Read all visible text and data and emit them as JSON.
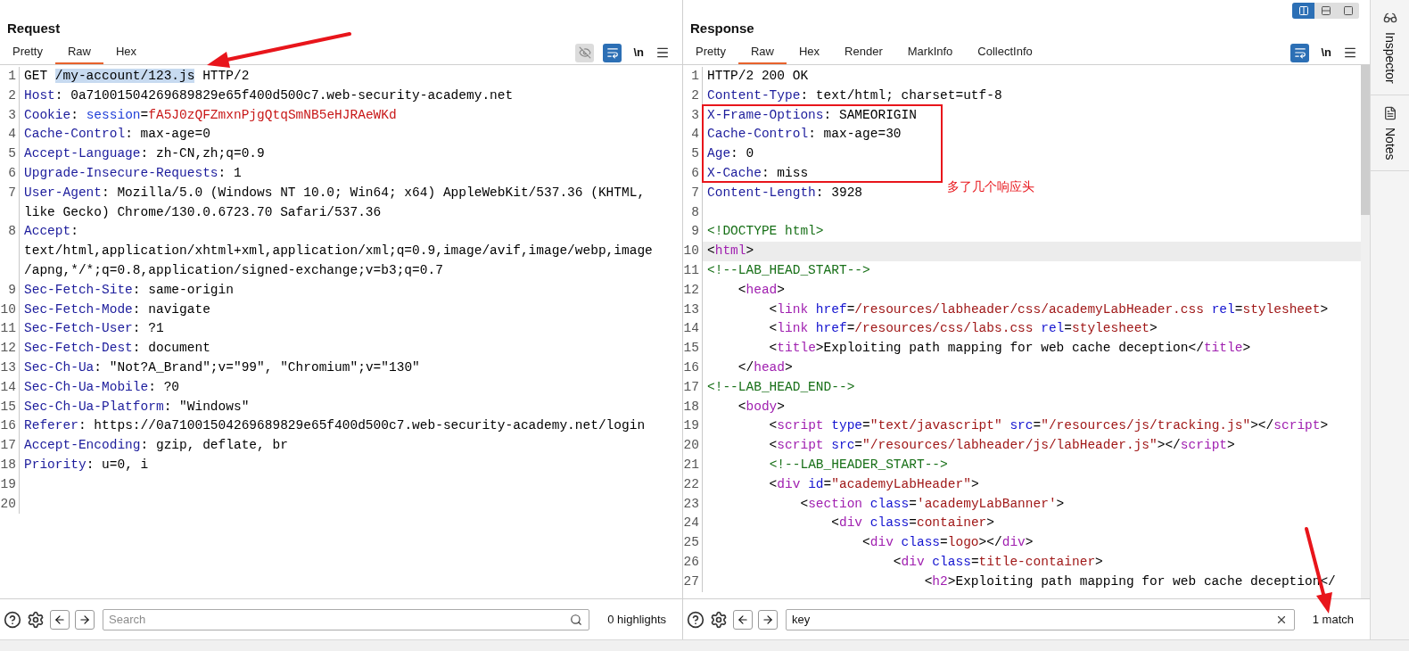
{
  "layout_toggle": [
    {
      "kind": "columns",
      "selected": true
    },
    {
      "kind": "rows",
      "selected": false
    },
    {
      "kind": "single",
      "selected": false
    }
  ],
  "request": {
    "title": "Request",
    "tabs": [
      {
        "label": "Pretty",
        "selected": false
      },
      {
        "label": "Raw",
        "selected": true
      },
      {
        "label": "Hex",
        "selected": false
      }
    ],
    "newline_toggle": "\\n",
    "lines": [
      {
        "number": "1",
        "rows": [
          [
            {
              "kind": "plain",
              "text": "GET "
            },
            {
              "kind": "selected",
              "text": "/my-account/123.js"
            },
            {
              "kind": "plain",
              "text": " HTTP/2"
            }
          ]
        ]
      },
      {
        "number": "2",
        "rows": [
          [
            {
              "kind": "name",
              "text": "Host"
            },
            {
              "kind": "plain",
              "text": ": 0a71001504269689829e65f400d500c7.web-security-academy.net"
            }
          ]
        ]
      },
      {
        "number": "3",
        "rows": [
          [
            {
              "kind": "name",
              "text": "Cookie"
            },
            {
              "kind": "plain",
              "text": ": "
            },
            {
              "kind": "cname",
              "text": "session"
            },
            {
              "kind": "plain",
              "text": "="
            },
            {
              "kind": "cvalue",
              "text": "fA5J0zQFZmxnPjgQtqSmNB5eHJRAeWKd"
            }
          ]
        ]
      },
      {
        "number": "4",
        "rows": [
          [
            {
              "kind": "name",
              "text": "Cache-Control"
            },
            {
              "kind": "plain",
              "text": ": max-age=0"
            }
          ]
        ]
      },
      {
        "number": "5",
        "rows": [
          [
            {
              "kind": "name",
              "text": "Accept-Language"
            },
            {
              "kind": "plain",
              "text": ": zh-CN,zh;q=0.9"
            }
          ]
        ]
      },
      {
        "number": "6",
        "rows": [
          [
            {
              "kind": "name",
              "text": "Upgrade-Insecure-Requests"
            },
            {
              "kind": "plain",
              "text": ": 1"
            }
          ]
        ]
      },
      {
        "number": "7",
        "rows": [
          [
            {
              "kind": "name",
              "text": "User-Agent"
            },
            {
              "kind": "plain",
              "text": ": Mozilla/5.0 (Windows NT 10.0; Win64; x64) AppleWebKit/537.36 (KHTML,"
            }
          ],
          [
            {
              "kind": "plain",
              "text": "like Gecko) Chrome/130.0.6723.70 Safari/537.36"
            }
          ]
        ]
      },
      {
        "number": "8",
        "rows": [
          [
            {
              "kind": "name",
              "text": "Accept"
            },
            {
              "kind": "plain",
              "text": ":"
            }
          ],
          [
            {
              "kind": "plain",
              "text": "text/html,application/xhtml+xml,application/xml;q=0.9,image/avif,image/webp,image"
            }
          ],
          [
            {
              "kind": "plain",
              "text": "/apng,*/*;q=0.8,application/signed-exchange;v=b3;q=0.7"
            }
          ]
        ]
      },
      {
        "number": "9",
        "rows": [
          [
            {
              "kind": "name",
              "text": "Sec-Fetch-Site"
            },
            {
              "kind": "plain",
              "text": ": same-origin"
            }
          ]
        ]
      },
      {
        "number": "10",
        "rows": [
          [
            {
              "kind": "name",
              "text": "Sec-Fetch-Mode"
            },
            {
              "kind": "plain",
              "text": ": navigate"
            }
          ]
        ]
      },
      {
        "number": "11",
        "rows": [
          [
            {
              "kind": "name",
              "text": "Sec-Fetch-User"
            },
            {
              "kind": "plain",
              "text": ": ?1"
            }
          ]
        ]
      },
      {
        "number": "12",
        "rows": [
          [
            {
              "kind": "name",
              "text": "Sec-Fetch-Dest"
            },
            {
              "kind": "plain",
              "text": ": document"
            }
          ]
        ]
      },
      {
        "number": "13",
        "rows": [
          [
            {
              "kind": "name",
              "text": "Sec-Ch-Ua"
            },
            {
              "kind": "plain",
              "text": ": \"Not?A_Brand\";v=\"99\", \"Chromium\";v=\"130\""
            }
          ]
        ]
      },
      {
        "number": "14",
        "rows": [
          [
            {
              "kind": "name",
              "text": "Sec-Ch-Ua-Mobile"
            },
            {
              "kind": "plain",
              "text": ": ?0"
            }
          ]
        ]
      },
      {
        "number": "15",
        "rows": [
          [
            {
              "kind": "name",
              "text": "Sec-Ch-Ua-Platform"
            },
            {
              "kind": "plain",
              "text": ": \"Windows\""
            }
          ]
        ]
      },
      {
        "number": "16",
        "rows": [
          [
            {
              "kind": "name",
              "text": "Referer"
            },
            {
              "kind": "plain",
              "text": ": https://0a71001504269689829e65f400d500c7.web-security-academy.net/login"
            }
          ]
        ]
      },
      {
        "number": "17",
        "rows": [
          [
            {
              "kind": "name",
              "text": "Accept-Encoding"
            },
            {
              "kind": "plain",
              "text": ": gzip, deflate, br"
            }
          ]
        ]
      },
      {
        "number": "18",
        "rows": [
          [
            {
              "kind": "name",
              "text": "Priority"
            },
            {
              "kind": "plain",
              "text": ": u=0, i"
            }
          ]
        ]
      },
      {
        "number": "19"
      },
      {
        "number": "20"
      }
    ],
    "search": {
      "placeholder": "Search",
      "result": "0 highlights"
    }
  },
  "response": {
    "title": "Response",
    "tabs": [
      {
        "label": "Pretty",
        "selected": false
      },
      {
        "label": "Raw",
        "selected": true
      },
      {
        "label": "Hex",
        "selected": false
      },
      {
        "label": "Render",
        "selected": false
      },
      {
        "label": "MarkInfo",
        "selected": false
      },
      {
        "label": "CollectInfo",
        "selected": false
      }
    ],
    "newline_toggle": "\\n",
    "lines": [
      {
        "number": "1",
        "current": false,
        "rows": [
          [
            {
              "kind": "plain",
              "text": "HTTP/2 200 OK"
            }
          ]
        ]
      },
      {
        "number": "2",
        "current": false,
        "rows": [
          [
            {
              "kind": "name",
              "text": "Content-Type"
            },
            {
              "kind": "plain",
              "text": ": text/html; charset=utf-8"
            }
          ]
        ]
      },
      {
        "number": "3",
        "current": false,
        "rows": [
          [
            {
              "kind": "name",
              "text": "X-Frame-Options"
            },
            {
              "kind": "plain",
              "text": ": SAMEORIGIN"
            }
          ]
        ]
      },
      {
        "number": "4",
        "current": false,
        "rows": [
          [
            {
              "kind": "name",
              "text": "Cache-Control"
            },
            {
              "kind": "plain",
              "text": ": max-age=30"
            }
          ]
        ]
      },
      {
        "number": "5",
        "current": false,
        "rows": [
          [
            {
              "kind": "name",
              "text": "Age"
            },
            {
              "kind": "plain",
              "text": ": 0"
            }
          ]
        ]
      },
      {
        "number": "6",
        "current": false,
        "rows": [
          [
            {
              "kind": "name",
              "text": "X-Cache"
            },
            {
              "kind": "plain",
              "text": ": miss"
            }
          ]
        ]
      },
      {
        "number": "7",
        "current": false,
        "rows": [
          [
            {
              "kind": "name",
              "text": "Content-Length"
            },
            {
              "kind": "plain",
              "text": ": 3928"
            }
          ]
        ]
      },
      {
        "number": "8",
        "current": false
      },
      {
        "number": "9",
        "current": false,
        "rows": [
          [
            {
              "kind": "comment",
              "text": "<!DOCTYPE html>"
            }
          ]
        ]
      },
      {
        "number": "10",
        "current": true,
        "rows": [
          [
            {
              "kind": "plain",
              "text": "<"
            },
            {
              "kind": "tag",
              "text": "html"
            },
            {
              "kind": "plain",
              "text": ">"
            }
          ]
        ]
      },
      {
        "number": "11",
        "current": false,
        "rows": [
          [
            {
              "kind": "comment",
              "text": "<!--LAB_HEAD_START-->"
            }
          ]
        ]
      },
      {
        "number": "12",
        "current": false,
        "rows": [
          [
            {
              "kind": "plain",
              "text": "    <"
            },
            {
              "kind": "tag",
              "text": "head"
            },
            {
              "kind": "plain",
              "text": ">"
            }
          ]
        ]
      },
      {
        "number": "13",
        "current": false,
        "rows": [
          [
            {
              "kind": "plain",
              "text": "        <"
            },
            {
              "kind": "tag",
              "text": "link"
            },
            {
              "kind": "plain",
              "text": " "
            },
            {
              "kind": "attr",
              "text": "href"
            },
            {
              "kind": "plain",
              "text": "="
            },
            {
              "kind": "value",
              "text": "/resources/labheader/css/academyLabHeader.css"
            },
            {
              "kind": "plain",
              "text": " "
            },
            {
              "kind": "attr",
              "text": "rel"
            },
            {
              "kind": "plain",
              "text": "="
            },
            {
              "kind": "value",
              "text": "stylesheet"
            },
            {
              "kind": "plain",
              "text": ">"
            }
          ]
        ]
      },
      {
        "number": "14",
        "current": false,
        "rows": [
          [
            {
              "kind": "plain",
              "text": "        <"
            },
            {
              "kind": "tag",
              "text": "link"
            },
            {
              "kind": "plain",
              "text": " "
            },
            {
              "kind": "attr",
              "text": "href"
            },
            {
              "kind": "plain",
              "text": "="
            },
            {
              "kind": "value",
              "text": "/resources/css/labs.css"
            },
            {
              "kind": "plain",
              "text": " "
            },
            {
              "kind": "attr",
              "text": "rel"
            },
            {
              "kind": "plain",
              "text": "="
            },
            {
              "kind": "value",
              "text": "stylesheet"
            },
            {
              "kind": "plain",
              "text": ">"
            }
          ]
        ]
      },
      {
        "number": "15",
        "current": false,
        "rows": [
          [
            {
              "kind": "plain",
              "text": "        <"
            },
            {
              "kind": "tag",
              "text": "title"
            },
            {
              "kind": "plain",
              "text": ">Exploiting path mapping for web cache deception</"
            },
            {
              "kind": "tag",
              "text": "title"
            },
            {
              "kind": "plain",
              "text": ">"
            }
          ]
        ]
      },
      {
        "number": "16",
        "current": false,
        "rows": [
          [
            {
              "kind": "plain",
              "text": "    </"
            },
            {
              "kind": "tag",
              "text": "head"
            },
            {
              "kind": "plain",
              "text": ">"
            }
          ]
        ]
      },
      {
        "number": "17",
        "current": false,
        "rows": [
          [
            {
              "kind": "comment",
              "text": "<!--LAB_HEAD_END-->"
            }
          ]
        ]
      },
      {
        "number": "18",
        "current": false,
        "rows": [
          [
            {
              "kind": "plain",
              "text": "    <"
            },
            {
              "kind": "tag",
              "text": "body"
            },
            {
              "kind": "plain",
              "text": ">"
            }
          ]
        ]
      },
      {
        "number": "19",
        "current": false,
        "rows": [
          [
            {
              "kind": "plain",
              "text": "        <"
            },
            {
              "kind": "tag",
              "text": "script"
            },
            {
              "kind": "plain",
              "text": " "
            },
            {
              "kind": "attr",
              "text": "type"
            },
            {
              "kind": "plain",
              "text": "="
            },
            {
              "kind": "value",
              "text": "\"text/javascript\""
            },
            {
              "kind": "plain",
              "text": " "
            },
            {
              "kind": "attr",
              "text": "src"
            },
            {
              "kind": "plain",
              "text": "="
            },
            {
              "kind": "value",
              "text": "\"/resources/js/tracking.js\""
            },
            {
              "kind": "plain",
              "text": "></"
            },
            {
              "kind": "tag",
              "text": "script"
            },
            {
              "kind": "plain",
              "text": ">"
            }
          ]
        ]
      },
      {
        "number": "20",
        "current": false,
        "rows": [
          [
            {
              "kind": "plain",
              "text": "        <"
            },
            {
              "kind": "tag",
              "text": "script"
            },
            {
              "kind": "plain",
              "text": " "
            },
            {
              "kind": "attr",
              "text": "src"
            },
            {
              "kind": "plain",
              "text": "="
            },
            {
              "kind": "value",
              "text": "\"/resources/labheader/js/labHeader.js\""
            },
            {
              "kind": "plain",
              "text": "></"
            },
            {
              "kind": "tag",
              "text": "script"
            },
            {
              "kind": "plain",
              "text": ">"
            }
          ]
        ]
      },
      {
        "number": "21",
        "current": false,
        "rows": [
          [
            {
              "kind": "plain",
              "text": "        "
            },
            {
              "kind": "comment",
              "text": "<!--LAB_HEADER_START-->"
            }
          ]
        ]
      },
      {
        "number": "22",
        "current": false,
        "rows": [
          [
            {
              "kind": "plain",
              "text": "        <"
            },
            {
              "kind": "tag",
              "text": "div"
            },
            {
              "kind": "plain",
              "text": " "
            },
            {
              "kind": "attr",
              "text": "id"
            },
            {
              "kind": "plain",
              "text": "="
            },
            {
              "kind": "value",
              "text": "\"academyLabHeader\""
            },
            {
              "kind": "plain",
              "text": ">"
            }
          ]
        ]
      },
      {
        "number": "23",
        "current": false,
        "rows": [
          [
            {
              "kind": "plain",
              "text": "            <"
            },
            {
              "kind": "tag",
              "text": "section"
            },
            {
              "kind": "plain",
              "text": " "
            },
            {
              "kind": "attr",
              "text": "class"
            },
            {
              "kind": "plain",
              "text": "="
            },
            {
              "kind": "value",
              "text": "'academyLabBanner'"
            },
            {
              "kind": "plain",
              "text": ">"
            }
          ]
        ]
      },
      {
        "number": "24",
        "current": false,
        "rows": [
          [
            {
              "kind": "plain",
              "text": "                <"
            },
            {
              "kind": "tag",
              "text": "div"
            },
            {
              "kind": "plain",
              "text": " "
            },
            {
              "kind": "attr",
              "text": "class"
            },
            {
              "kind": "plain",
              "text": "="
            },
            {
              "kind": "value",
              "text": "container"
            },
            {
              "kind": "plain",
              "text": ">"
            }
          ]
        ]
      },
      {
        "number": "25",
        "current": false,
        "rows": [
          [
            {
              "kind": "plain",
              "text": "                    <"
            },
            {
              "kind": "tag",
              "text": "div"
            },
            {
              "kind": "plain",
              "text": " "
            },
            {
              "kind": "attr",
              "text": "class"
            },
            {
              "kind": "plain",
              "text": "="
            },
            {
              "kind": "value",
              "text": "logo"
            },
            {
              "kind": "plain",
              "text": "></"
            },
            {
              "kind": "tag",
              "text": "div"
            },
            {
              "kind": "plain",
              "text": ">"
            }
          ]
        ]
      },
      {
        "number": "26",
        "current": false,
        "rows": [
          [
            {
              "kind": "plain",
              "text": "                        <"
            },
            {
              "kind": "tag",
              "text": "div"
            },
            {
              "kind": "plain",
              "text": " "
            },
            {
              "kind": "attr",
              "text": "class"
            },
            {
              "kind": "plain",
              "text": "="
            },
            {
              "kind": "value",
              "text": "title-container"
            },
            {
              "kind": "plain",
              "text": ">"
            }
          ]
        ]
      },
      {
        "number": "27",
        "current": false,
        "rows": [
          [
            {
              "kind": "plain",
              "text": "                            <"
            },
            {
              "kind": "tag",
              "text": "h2"
            },
            {
              "kind": "plain",
              "text": ">Exploiting path mapping for web cache deception</"
            }
          ]
        ]
      }
    ],
    "search": {
      "value": "key",
      "result": "1 match"
    }
  },
  "side_panel": [
    {
      "kind": "inspector",
      "label": "Inspector"
    },
    {
      "kind": "notes",
      "label": "Notes"
    }
  ],
  "annotation": {
    "note": "多了几个响应头"
  }
}
